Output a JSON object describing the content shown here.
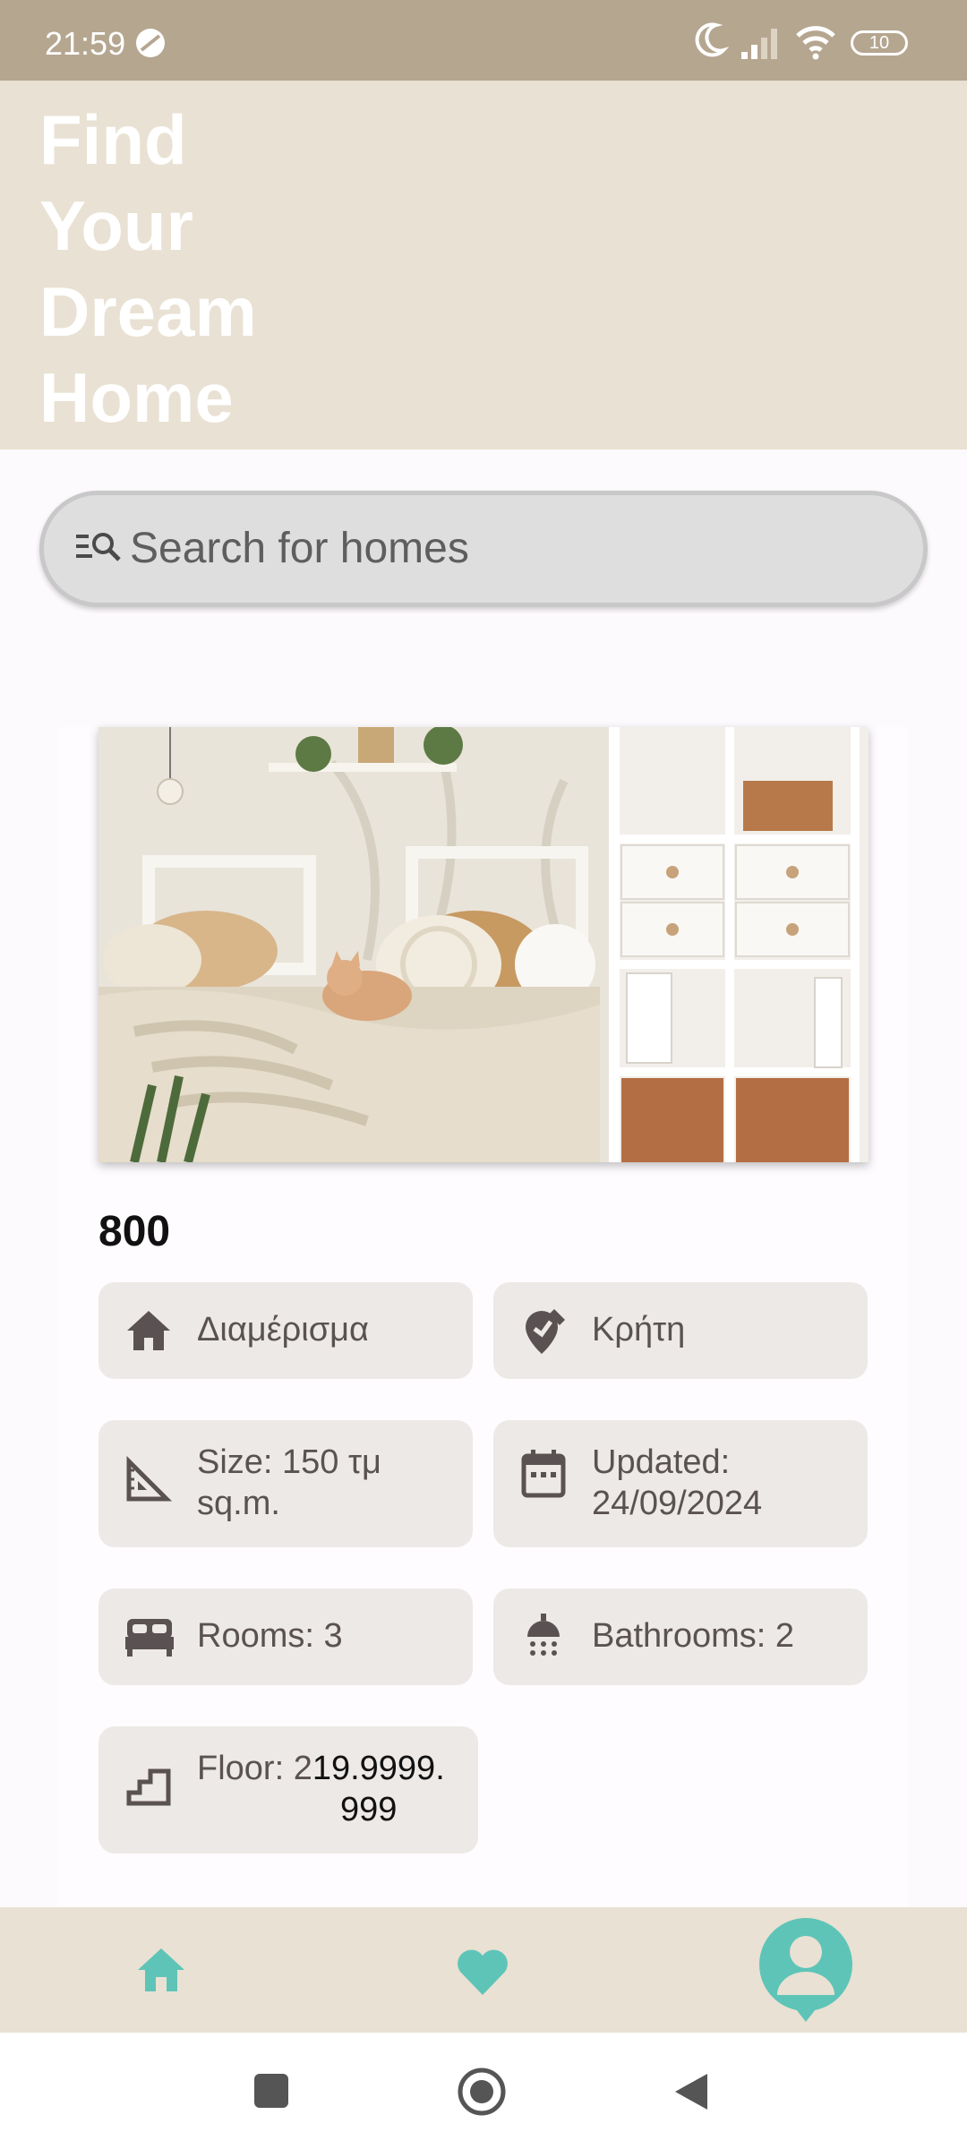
{
  "status_bar": {
    "time": "21:59",
    "battery": "10"
  },
  "header": {
    "title": "Find Your Dream Home"
  },
  "search": {
    "placeholder": "Search for homes"
  },
  "listing": {
    "price": "800",
    "type": "Διαμέρισμα",
    "location": "Κρήτη",
    "size": "Size: 150 τμ sq.m.",
    "updated": "Updated: 24/09/2024",
    "rooms": "Rooms: 3",
    "bathrooms": "Bathrooms: 2",
    "floor_prefix": "Floor: 2",
    "floor_value": "19.9999.",
    "floor_value_line2": "999"
  },
  "bottom_nav": {
    "items": [
      {
        "icon": "home-icon"
      },
      {
        "icon": "heart-icon"
      },
      {
        "icon": "profile-icon"
      }
    ]
  },
  "colors": {
    "status_bar": "#b5a690",
    "header": "#e9e1d3",
    "accent": "#5ec4b8",
    "chip": "#ede9e7"
  }
}
